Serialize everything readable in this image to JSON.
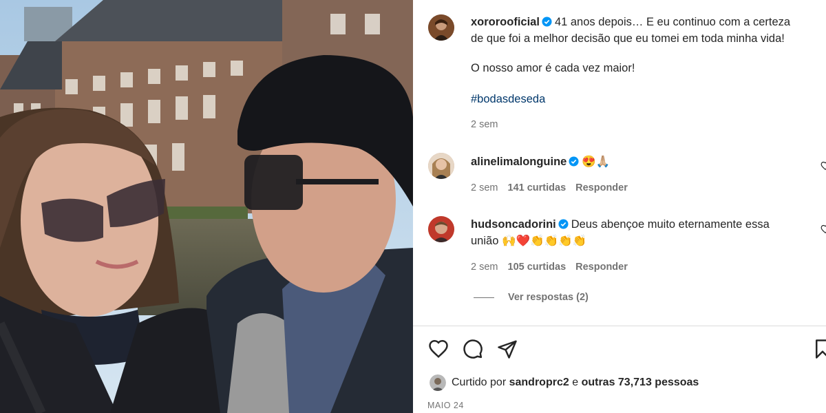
{
  "post": {
    "author": "xororooficial",
    "caption_line1": "41 anos depois… E eu continuo com a certeza",
    "caption_line2": "de que foi a melhor decisão que eu tomei em toda minha vida!",
    "caption_line3": "O nosso amor é cada vez maior!",
    "hashtag": "#bodasdeseda",
    "time": "2 sem"
  },
  "comments": [
    {
      "user": "alinelimalonguine",
      "text": "😍🙏🏼",
      "time": "2 sem",
      "likes": "141 curtidas",
      "reply": "Responder"
    },
    {
      "user": "hudsoncadorini",
      "text_line1": "Deus abençoe muito eternamente essa",
      "text_line2": "união 🙌❤️👏👏👏👏",
      "time": "2 sem",
      "likes": "105 curtidas",
      "reply": "Responder",
      "view_replies": "Ver respostas (2)"
    }
  ],
  "footer": {
    "liked_prefix": "Curtido por",
    "liked_user": "sandroprc2",
    "liked_and": "e",
    "liked_others": "outras 73,713 pessoas",
    "date": "MAIO 24"
  },
  "icons": [
    "heart-icon",
    "comment-icon",
    "share-icon",
    "bookmark-icon",
    "verified-icon"
  ],
  "colors": {
    "verified": "#0095f6",
    "hashtag": "#00376b",
    "muted": "#737373",
    "text": "#262626"
  }
}
